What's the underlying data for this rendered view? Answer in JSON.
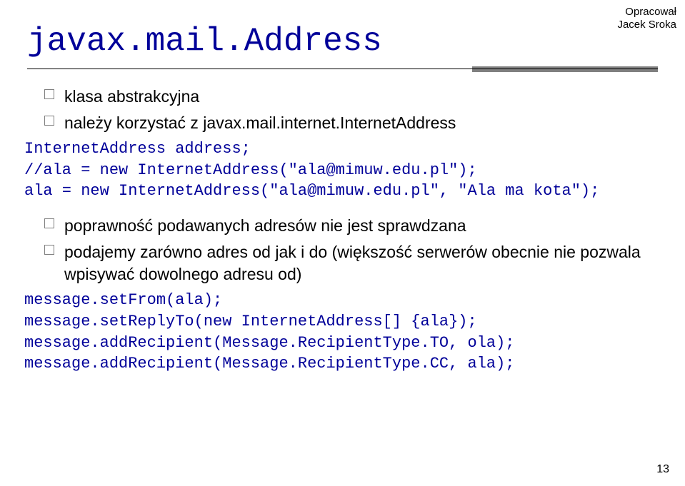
{
  "header": {
    "line1": "Opracował",
    "line2": "Jacek Sroka"
  },
  "title": "javax.mail.Address",
  "bullets1": {
    "b0": "klasa abstrakcyjna",
    "b1": "należy korzystać z javax.mail.internet.InternetAddress"
  },
  "code1": {
    "l0": "InternetAddress address;",
    "l1": "//ala = new InternetAddress(\"ala@mimuw.edu.pl\");",
    "l2": "ala = new InternetAddress(\"ala@mimuw.edu.pl\", \"Ala ma kota\");"
  },
  "bullets2": {
    "b0": "poprawność podawanych adresów nie jest sprawdzana",
    "b1": "podajemy zarówno adres od jak i do (większość serwerów obecnie nie pozwala wpisywać dowolnego adresu od)"
  },
  "code2": {
    "l0": "message.setFrom(ala);",
    "l1": "message.setReplyTo(new InternetAddress[] {ala});",
    "l2": "message.addRecipient(Message.RecipientType.TO, ola);",
    "l3": "message.addRecipient(Message.RecipientType.CC, ala);"
  },
  "page": "13"
}
